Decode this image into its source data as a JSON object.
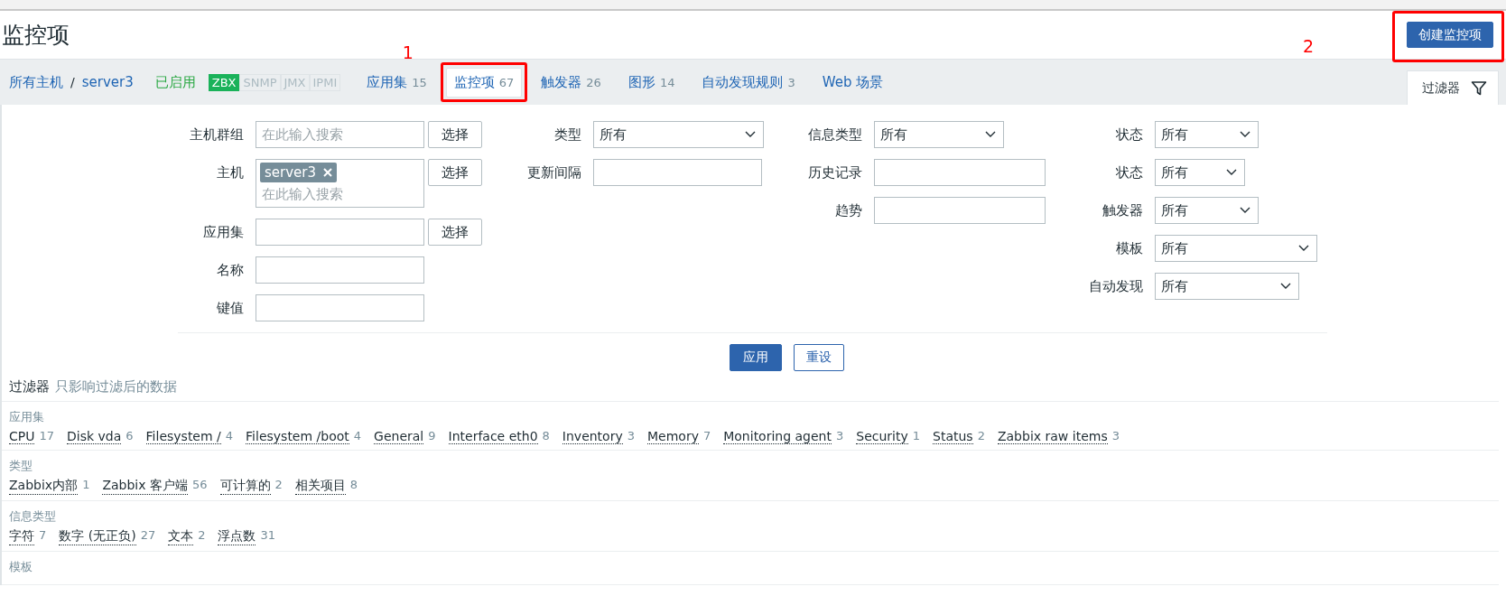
{
  "page_title": "监控项",
  "create_button": "创建监控项",
  "annotations": [
    {
      "label": "1"
    },
    {
      "label": "2"
    }
  ],
  "breadcrumb": [
    {
      "label": "所有主机"
    },
    {
      "label": "server3"
    }
  ],
  "breadcrumb_separator": "/",
  "host_status": "已启用",
  "availability": [
    {
      "label": "ZBX",
      "on": true
    },
    {
      "label": "SNMP",
      "on": false
    },
    {
      "label": "JMX",
      "on": false
    },
    {
      "label": "IPMI",
      "on": false
    }
  ],
  "tabs": [
    {
      "label": "应用集",
      "count": "15",
      "selected": false
    },
    {
      "label": "监控项",
      "count": "67",
      "selected": true
    },
    {
      "label": "触发器",
      "count": "26",
      "selected": false
    },
    {
      "label": "图形",
      "count": "14",
      "selected": false
    },
    {
      "label": "自动发现规则",
      "count": "3",
      "selected": false
    },
    {
      "label": "Web 场景",
      "selected": false
    }
  ],
  "filter_tab": {
    "label": "过滤器"
  },
  "filter": {
    "columns": [
      [
        {
          "kind": "multiselect",
          "label": "主机群组",
          "placeholder": "在此输入搜索",
          "button": "选择"
        },
        {
          "kind": "multiselect",
          "label": "主机",
          "tags": [
            "server3"
          ],
          "placeholder": "在此输入搜索",
          "button": "选择"
        },
        {
          "kind": "multiselect",
          "label": "应用集",
          "button": "选择"
        },
        {
          "kind": "input",
          "label": "名称"
        },
        {
          "kind": "input",
          "label": "键值"
        }
      ],
      [
        {
          "kind": "select",
          "label": "类型",
          "value": "所有"
        },
        {
          "kind": "input",
          "label": "更新间隔"
        }
      ],
      [
        {
          "kind": "select",
          "label": "信息类型",
          "value": "所有"
        },
        {
          "kind": "input",
          "label": "历史记录"
        },
        {
          "kind": "input",
          "label": "趋势"
        }
      ],
      [
        {
          "kind": "select",
          "label": "状态",
          "value": "所有"
        },
        {
          "kind": "select",
          "label": "状态",
          "value": "所有"
        },
        {
          "kind": "select",
          "label": "触发器",
          "value": "所有"
        },
        {
          "kind": "select",
          "label": "模板",
          "value": "所有"
        },
        {
          "kind": "select",
          "label": "自动发现",
          "value": "所有"
        }
      ]
    ]
  },
  "filter_buttons": {
    "apply": "应用",
    "reset": "重设"
  },
  "subfilter": {
    "title": "过滤器",
    "hint": "只影响过滤后的数据",
    "groups": [
      {
        "name": "应用集",
        "items": [
          {
            "label": "CPU",
            "count": "17"
          },
          {
            "label": "Disk vda",
            "count": "6"
          },
          {
            "label": "Filesystem /",
            "count": "4"
          },
          {
            "label": "Filesystem /boot",
            "count": "4"
          },
          {
            "label": "General",
            "count": "9"
          },
          {
            "label": "Interface eth0",
            "count": "8"
          },
          {
            "label": "Inventory",
            "count": "3"
          },
          {
            "label": "Memory",
            "count": "7"
          },
          {
            "label": "Monitoring agent",
            "count": "3"
          },
          {
            "label": "Security",
            "count": "1"
          },
          {
            "label": "Status",
            "count": "2"
          },
          {
            "label": "Zabbix raw items",
            "count": "3"
          }
        ]
      },
      {
        "name": "类型",
        "items": [
          {
            "label": "Zabbix内部",
            "count": "1"
          },
          {
            "label": "Zabbix 客户端",
            "count": "56"
          },
          {
            "label": "可计算的",
            "count": "2"
          },
          {
            "label": "相关项目",
            "count": "8"
          }
        ]
      },
      {
        "name": "信息类型",
        "items": [
          {
            "label": "字符",
            "count": "7"
          },
          {
            "label": "数字 (无正负)",
            "count": "27"
          },
          {
            "label": "文本",
            "count": "2"
          },
          {
            "label": "浮点数",
            "count": "31"
          }
        ]
      },
      {
        "name": "模板"
      }
    ]
  }
}
